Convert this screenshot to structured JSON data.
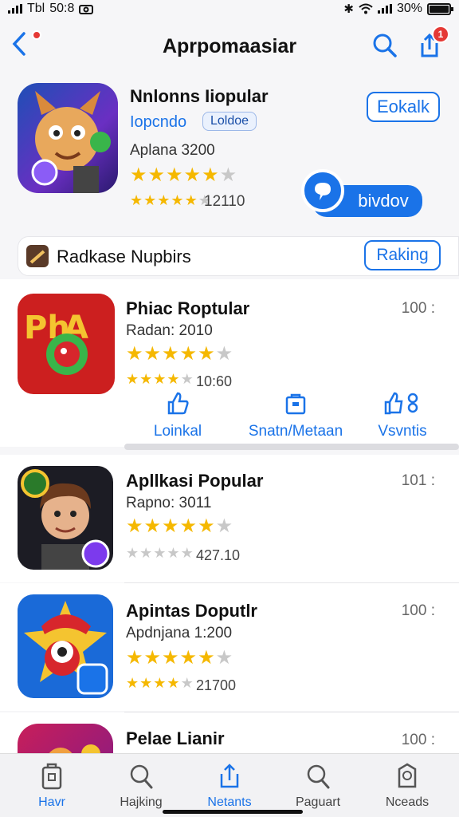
{
  "status": {
    "carrier": "Tbl",
    "time": "50:8",
    "battery": "30%"
  },
  "header": {
    "title": "Aprpomaasiar",
    "cart_badge": "1"
  },
  "featured": {
    "name": "Nnlonns Iiopular",
    "developer": "Iopcndo",
    "tag": "Loldoe",
    "downloads": "Aplana 3200",
    "rating": 4.5,
    "rating_count": "12110",
    "action_label": "Eokalk",
    "cta_label": "bivdov"
  },
  "section": {
    "title": "Radkase Nupbirs",
    "button_label": "Raking"
  },
  "apps": [
    {
      "name": "Phiac Roptular",
      "sub": "Radan: 2010",
      "count": "10:60",
      "rank": "100 :"
    },
    {
      "name": "Apllkasi Popular",
      "sub": "Rapno: 3011",
      "count": "427.10",
      "rank": "101 :"
    },
    {
      "name": "Apintas Doputlr",
      "sub": "Apdnjana 1:200",
      "count": "21700",
      "rank": "100 :"
    },
    {
      "name": "Pelae Lianir",
      "rank": "100 :"
    }
  ],
  "actions": [
    {
      "label": "Loinkal",
      "icon": "thumb-up-icon"
    },
    {
      "label": "Snatn/Metaan",
      "icon": "bag-icon"
    },
    {
      "label": "Vsvntis",
      "icon": "share-icon"
    }
  ],
  "tabs": [
    {
      "label": "Havr",
      "icon": "home-icon",
      "active": true
    },
    {
      "label": "Hajking",
      "icon": "search-icon"
    },
    {
      "label": "Netants",
      "icon": "share-icon"
    },
    {
      "label": "Paguart",
      "icon": "search-icon"
    },
    {
      "label": "Nceads",
      "icon": "tag-icon"
    }
  ],
  "colors": {
    "accent": "#1a73e8",
    "star": "#f5b800",
    "badge": "#e53935"
  }
}
